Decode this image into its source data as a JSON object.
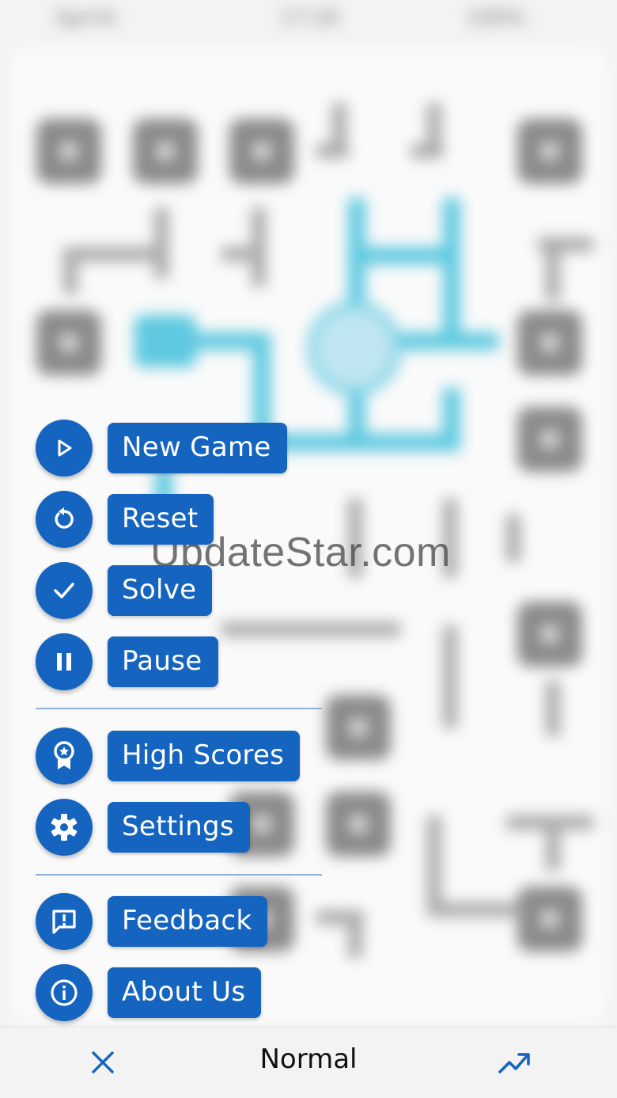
{
  "status_bar": {
    "carrier": "Sprint",
    "time": "17:20",
    "battery": "100%"
  },
  "menu": {
    "primary": [
      {
        "id": "new-game",
        "label": "New Game",
        "icon": "play-icon"
      },
      {
        "id": "reset",
        "label": "Reset",
        "icon": "reset-icon"
      },
      {
        "id": "solve",
        "label": "Solve",
        "icon": "check-icon"
      },
      {
        "id": "pause",
        "label": "Pause",
        "icon": "pause-icon"
      }
    ],
    "secondary": [
      {
        "id": "high-scores",
        "label": "High Scores",
        "icon": "award-icon"
      },
      {
        "id": "settings",
        "label": "Settings",
        "icon": "gear-icon"
      }
    ],
    "tertiary": [
      {
        "id": "feedback",
        "label": "Feedback",
        "icon": "feedback-icon"
      },
      {
        "id": "about-us",
        "label": "About Us",
        "icon": "info-icon"
      }
    ]
  },
  "watermark": "UpdateStar.com",
  "bottom_bar": {
    "mode": "Normal",
    "close_icon": "close-icon",
    "stats_icon": "trending-up-icon"
  },
  "colors": {
    "accent": "#1565c0",
    "pipe_connected": "#5ec9e0",
    "pipe_idle": "#a9a9a9"
  }
}
